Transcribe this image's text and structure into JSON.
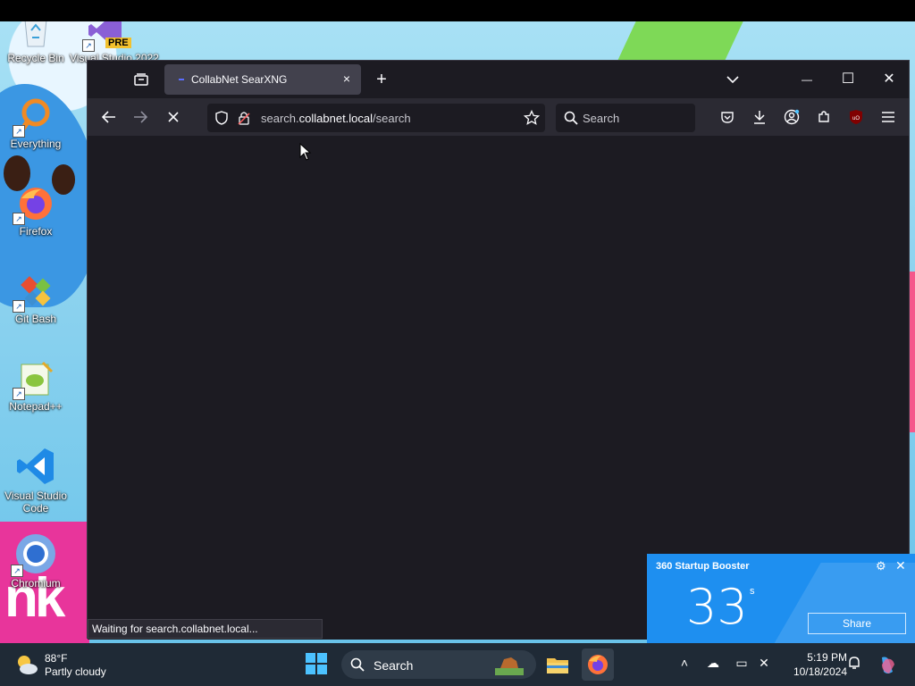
{
  "desktop": {
    "icons": [
      {
        "label": "Recycle Bin"
      },
      {
        "label": "Visual Studio 2022"
      },
      {
        "label": "Everything"
      },
      {
        "label": "Firefox"
      },
      {
        "label": "Git Bash"
      },
      {
        "label": "Notepad++"
      },
      {
        "label": "Visual Studio Code"
      },
      {
        "label": "Chromium"
      }
    ],
    "vs_badge": "PRE",
    "wallpaper_letters": "nk"
  },
  "browser": {
    "tab": {
      "title": "CollabNet SearXNG",
      "close": "×"
    },
    "new_tab": "+",
    "url_prefix": "search.",
    "url_domain": "collabnet.local",
    "url_path": "/search",
    "search_placeholder": "Search",
    "status_text": "Waiting for search.collabnet.local...",
    "window_controls": {
      "minimize": "—",
      "maximize": "☐",
      "close": "✕"
    }
  },
  "booster": {
    "title": "360 Startup Booster",
    "seconds": "33",
    "unit": "s",
    "share": "Share"
  },
  "taskbar": {
    "weather_temp": "88°F",
    "weather_condition": "Partly cloudy",
    "search_label": "Search",
    "time": "5:19 PM",
    "date": "10/18/2024"
  },
  "colors": {
    "browser_bg": "#1c1b22",
    "toolbar_bg": "#2b2a33",
    "booster_bg": "#1e8ff0",
    "taskbar_bg": "#1f2a36",
    "accent": "#4cc2ff"
  }
}
